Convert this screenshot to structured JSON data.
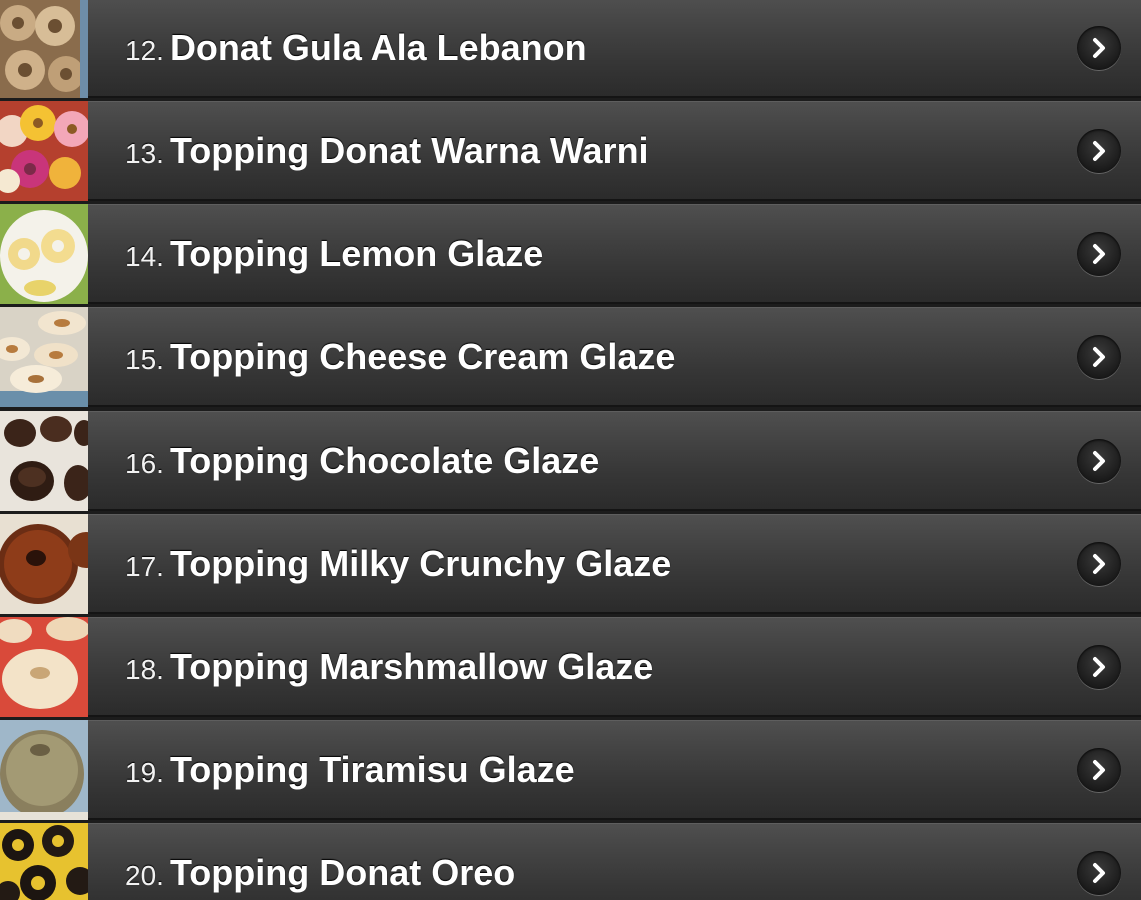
{
  "items": [
    {
      "number": "12.",
      "title": "Donat Gula Ala Lebanon",
      "thumb_icon": "sugar-donut-thumbnail"
    },
    {
      "number": "13.",
      "title": "Topping Donat Warna Warni",
      "thumb_icon": "colorful-donut-thumbnail"
    },
    {
      "number": "14.",
      "title": "Topping Lemon Glaze",
      "thumb_icon": "lemon-glaze-thumbnail"
    },
    {
      "number": "15.",
      "title": "Topping Cheese Cream Glaze",
      "thumb_icon": "cheese-cream-thumbnail"
    },
    {
      "number": "16.",
      "title": "Topping Chocolate Glaze",
      "thumb_icon": "chocolate-glaze-thumbnail"
    },
    {
      "number": "17.",
      "title": "Topping Milky Crunchy Glaze",
      "thumb_icon": "milky-crunchy-thumbnail"
    },
    {
      "number": "18.",
      "title": "Topping Marshmallow Glaze",
      "thumb_icon": "marshmallow-thumbnail"
    },
    {
      "number": "19.",
      "title": "Topping Tiramisu Glaze",
      "thumb_icon": "tiramisu-thumbnail"
    },
    {
      "number": "20.",
      "title": "Topping Donat Oreo",
      "thumb_icon": "oreo-donut-thumbnail"
    }
  ],
  "colors": {
    "bar": "#3c3c3c",
    "text": "#ffffff",
    "chevron_bg": "#1a1a1a"
  }
}
